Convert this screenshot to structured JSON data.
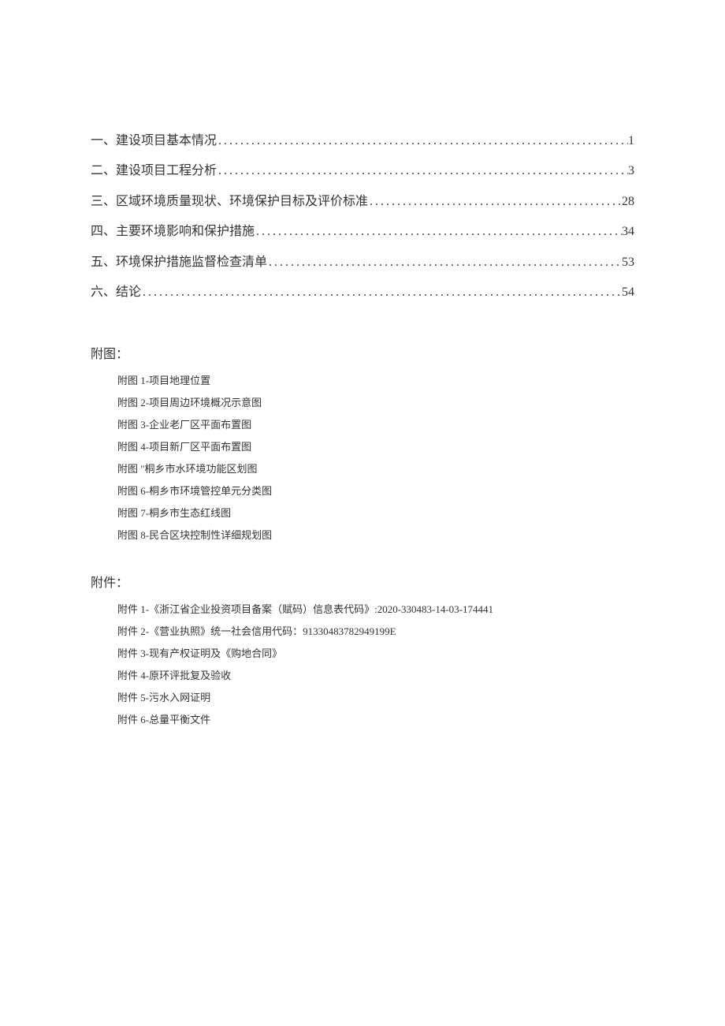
{
  "toc": [
    {
      "label": "一、建设项目基本情况",
      "page": "1"
    },
    {
      "label": "二、建设项目工程分析",
      "page": "3"
    },
    {
      "label": "三、区域环境质量现状、环境保护目标及评价标准",
      "page": "28"
    },
    {
      "label": "四、主要环境影响和保护措施",
      "page": "34"
    },
    {
      "label": "五、环境保护措施监督检查清单",
      "page": "53"
    },
    {
      "label": "六、结论",
      "page": "54"
    }
  ],
  "figures_heading": "附图：",
  "figures": [
    "附图 1-项目地理位置",
    "附图 2-项目周边环境概况示意图",
    "附图 3-企业老厂区平面布置图",
    "附图 4-项目新厂区平面布置图",
    "附图 \"桐乡市水环境功能区划图",
    "附图 6-桐乡市环境管控单元分类图",
    "附图 7-桐乡市生态红线图",
    "附图 8-民合区块控制性详细规划图"
  ],
  "attachments_heading": "附件：",
  "attachments": [
    "附件 1-《浙江省企业投资项目备案（赋码）信息表代码》:2020-330483-14-03-174441",
    "附件 2-《营业执照》统一社会信用代码：91330483782949199E",
    "附件 3-现有产权证明及《购地合同》",
    "附件 4-原环评批复及验收",
    "附件 5-污水入网证明",
    "附件 6-总量平衡文件"
  ]
}
